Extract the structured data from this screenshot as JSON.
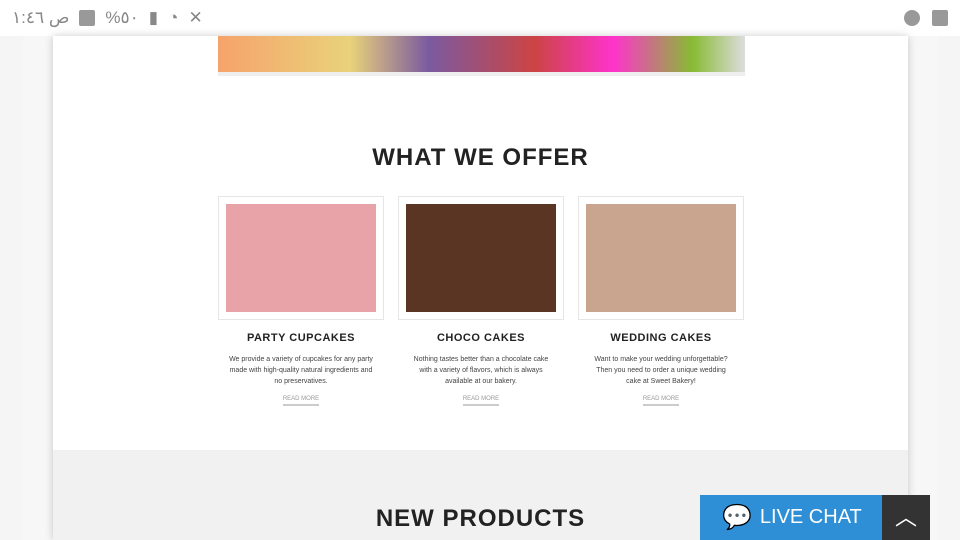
{
  "status_bar": {
    "time": "ص ١:٤٦",
    "battery": "%٥٠"
  },
  "section_offer": {
    "title": "WHAT WE OFFER",
    "cards": [
      {
        "title": "PARTY CUPCAKES",
        "text": "We provide a variety of cupcakes for any party made with high-quality natural ingredients and no preservatives.",
        "link": "READ MORE",
        "color": "#e7a3a8"
      },
      {
        "title": "CHOCO CAKES",
        "text": "Nothing tastes better than a chocolate cake with a variety of flavors, which is always available at our bakery.",
        "link": "READ MORE",
        "color": "#5a3523"
      },
      {
        "title": "WEDDING CAKES",
        "text": "Want to make your wedding unforgettable? Then you need to order a unique wedding cake at Sweet Bakery!",
        "link": "READ MORE",
        "color": "#c9a48e"
      }
    ]
  },
  "section_products": {
    "title": "NEW PRODUCTS"
  },
  "chat": {
    "label": "LIVE CHAT"
  }
}
